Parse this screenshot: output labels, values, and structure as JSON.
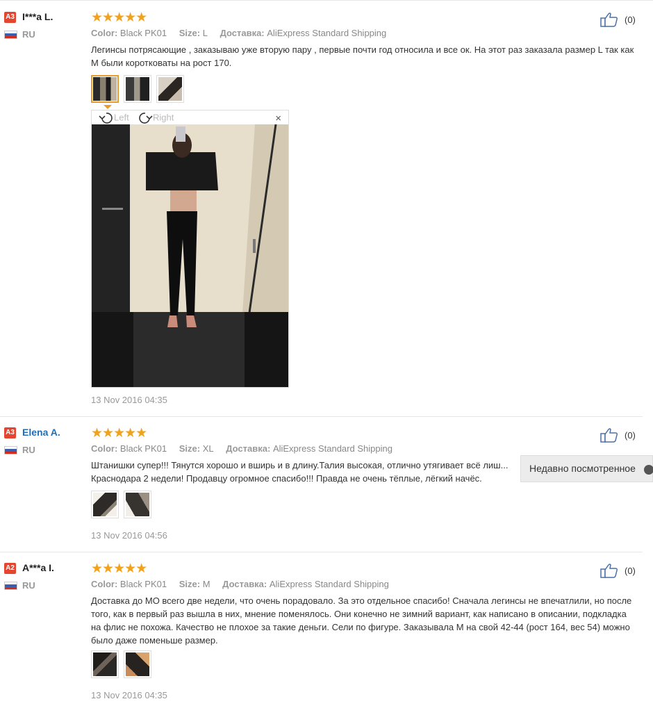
{
  "reviews": [
    {
      "level": "A3",
      "name": "I***a L.",
      "country": "RU",
      "stars": "★★★★★",
      "color_label": "Color:",
      "color_value": "Black PK01",
      "size_label": "Size:",
      "size_value": "L",
      "ship_label": "Доставка:",
      "ship_value": "AliExpress Standard Shipping",
      "text": "Легинсы потрясающие , заказываю уже вторую пару , первые почти год относила и все ок. На этот раз заказала размер L так как M были коротковаты на рост 170.",
      "likes": "(0)",
      "date": "13 Nov 2016 04:35"
    },
    {
      "level": "A3",
      "name": "Elena A.",
      "country": "RU",
      "stars": "★★★★★",
      "color_label": "Color:",
      "color_value": "Black PK01",
      "size_label": "Size:",
      "size_value": "XL",
      "ship_label": "Доставка:",
      "ship_value": "AliExpress Standard Shipping",
      "text": "Штанишки супер!!! Тянутся хорошо и вширь и в длину.Талия высокая, отлично утягивает всё лиш... Краснодара 2 недели! Продавцу огромное спасибо!!! Правда не очень тёплые, лёгкий начёс.",
      "likes": "(0)",
      "date": "13 Nov 2016 04:56"
    },
    {
      "level": "A2",
      "name": "A***a I.",
      "country": "RU",
      "stars": "★★★★★",
      "color_label": "Color:",
      "color_value": "Black PK01",
      "size_label": "Size:",
      "size_value": "M",
      "ship_label": "Доставка:",
      "ship_value": "AliExpress Standard Shipping",
      "text": "Доставка до МО всего две недели, что очень порадовало. За это отдельное спасибо! Сначала легинсы не впечатлили, но после того, как в первый раз вышла в них, мнение поменялось. Они конечно не зимний вариант, как написано в описании, подкладка на флис не похожа. Качество не плохое за такие деньги. Сели по фигуре. Заказывала М на свой 42-44 (рост 164, вес 54) можно было даже поменьше размер.",
      "likes": "(0)",
      "date": "13 Nov 2016 04:35"
    }
  ],
  "viewer": {
    "rotate_left": "Left",
    "rotate_right": "Right",
    "close": "×"
  },
  "recently_viewed": "Недавно посмотренное",
  "colors": {
    "star": "#f1a11b",
    "level_badge": "#e34531",
    "link": "#1e6fb8",
    "active_thumb": "#ea9c2b"
  }
}
